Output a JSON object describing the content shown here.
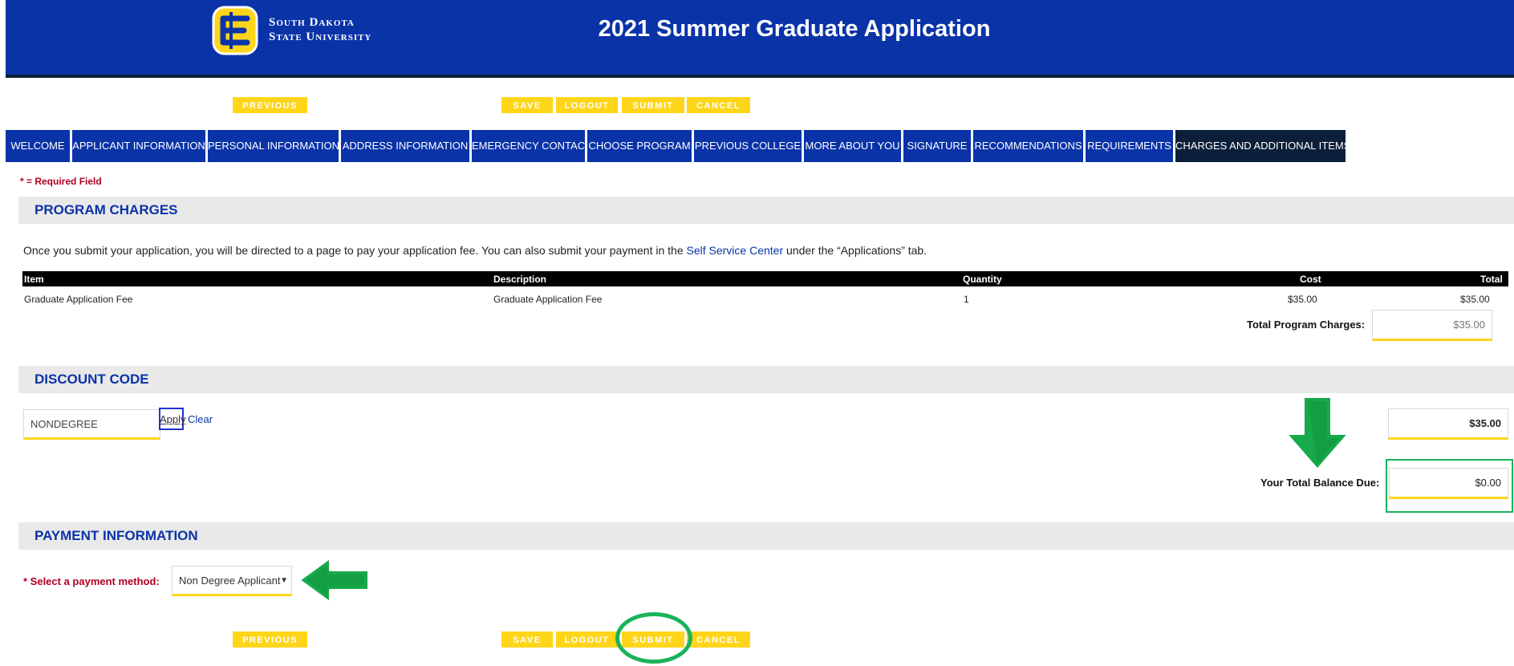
{
  "header": {
    "university_line1": "South Dakota",
    "university_line2": "State University",
    "title": "2021 Summer Graduate Application"
  },
  "nav_buttons": {
    "previous": "PREVIOUS",
    "save": "SAVE",
    "logout": "LOGOUT",
    "submit": "SUBMIT",
    "cancel": "CANCEL"
  },
  "tabs": [
    {
      "label": "WELCOME"
    },
    {
      "label": "APPLICANT INFORMATION"
    },
    {
      "label": "PERSONAL INFORMATION"
    },
    {
      "label": "ADDRESS INFORMATION"
    },
    {
      "label": "EMERGENCY CONTACT"
    },
    {
      "label": "CHOOSE PROGRAM"
    },
    {
      "label": "PREVIOUS COLLEGE"
    },
    {
      "label": "MORE ABOUT YOU"
    },
    {
      "label": "SIGNATURE"
    },
    {
      "label": "RECOMMENDATIONS"
    },
    {
      "label": "REQUIREMENTS"
    },
    {
      "label": "CHARGES AND ADDITIONAL ITEMS",
      "active": true
    }
  ],
  "required_note": "* = Required Field",
  "program_charges": {
    "title": "PROGRAM CHARGES",
    "info_before": "Once you submit your application, you will be directed to a page to pay your application fee.  You can also submit your payment in the",
    "info_link": "Self Service Center",
    "info_after": "under the “Applications” tab.",
    "columns": {
      "item": "Item",
      "description": "Description",
      "quantity": "Quantity",
      "cost": "Cost",
      "total": "Total"
    },
    "rows": [
      {
        "item": "Graduate Application Fee",
        "description": "Graduate Application Fee",
        "quantity": "1",
        "cost": "$35.00",
        "total": "$35.00"
      }
    ],
    "total_label": "Total Program Charges:",
    "total_value": "$35.00"
  },
  "discount": {
    "title": "DISCOUNT CODE",
    "code_value": "NONDEGREE",
    "apply": "Apply",
    "clear": "Clear",
    "amount": "$35.00",
    "balance_label": "Your Total Balance Due:",
    "balance_value": "$0.00"
  },
  "payment": {
    "title": "PAYMENT INFORMATION",
    "method_label": "* Select a payment method:",
    "method_value": "Non Degree Applicant"
  },
  "colors": {
    "brand_blue": "#0a33a8",
    "brand_yellow": "#ffd51a",
    "annotation_green": "#19b35a"
  }
}
